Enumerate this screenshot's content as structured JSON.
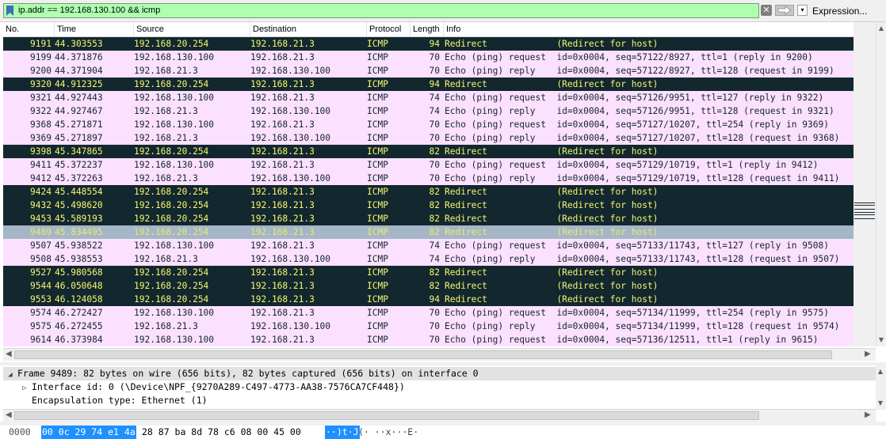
{
  "filter": {
    "text": "ip.addr == 192.168.130.100 && icmp",
    "expression_label": "Expression...",
    "clear_glyph": "✕",
    "dropdown_glyph": "▾",
    "bookmark_icon": "bookmark-icon",
    "background_color": "#afffaf"
  },
  "columns": {
    "no": "No.",
    "time": "Time",
    "source": "Source",
    "destination": "Destination",
    "protocol": "Protocol",
    "length": "Length",
    "info": "Info"
  },
  "colors": {
    "redirect_bg": "#12272e",
    "redirect_fg": "#f7f771",
    "echo_bg": "#fce0ff",
    "echo_fg": "#12272e",
    "selected_bg": "#a5b6c8"
  },
  "packets": [
    {
      "no": "9191",
      "time": "44.303553",
      "src": "192.168.20.254",
      "dst": "192.168.21.3",
      "proto": "ICMP",
      "len": "94",
      "info": "Redirect             (Redirect for host)",
      "kind": "redirect"
    },
    {
      "no": "9199",
      "time": "44.371876",
      "src": "192.168.130.100",
      "dst": "192.168.21.3",
      "proto": "ICMP",
      "len": "70",
      "info": "Echo (ping) request  id=0x0004, seq=57122/8927, ttl=1 (reply in 9200)",
      "kind": "echo"
    },
    {
      "no": "9200",
      "time": "44.371904",
      "src": "192.168.21.3",
      "dst": "192.168.130.100",
      "proto": "ICMP",
      "len": "70",
      "info": "Echo (ping) reply    id=0x0004, seq=57122/8927, ttl=128 (request in 9199)",
      "kind": "echo"
    },
    {
      "no": "9320",
      "time": "44.912325",
      "src": "192.168.20.254",
      "dst": "192.168.21.3",
      "proto": "ICMP",
      "len": "94",
      "info": "Redirect             (Redirect for host)",
      "kind": "redirect"
    },
    {
      "no": "9321",
      "time": "44.927443",
      "src": "192.168.130.100",
      "dst": "192.168.21.3",
      "proto": "ICMP",
      "len": "74",
      "info": "Echo (ping) request  id=0x0004, seq=57126/9951, ttl=127 (reply in 9322)",
      "kind": "echo"
    },
    {
      "no": "9322",
      "time": "44.927467",
      "src": "192.168.21.3",
      "dst": "192.168.130.100",
      "proto": "ICMP",
      "len": "74",
      "info": "Echo (ping) reply    id=0x0004, seq=57126/9951, ttl=128 (request in 9321)",
      "kind": "echo"
    },
    {
      "no": "9368",
      "time": "45.271871",
      "src": "192.168.130.100",
      "dst": "192.168.21.3",
      "proto": "ICMP",
      "len": "70",
      "info": "Echo (ping) request  id=0x0004, seq=57127/10207, ttl=254 (reply in 9369)",
      "kind": "echo"
    },
    {
      "no": "9369",
      "time": "45.271897",
      "src": "192.168.21.3",
      "dst": "192.168.130.100",
      "proto": "ICMP",
      "len": "70",
      "info": "Echo (ping) reply    id=0x0004, seq=57127/10207, ttl=128 (request in 9368)",
      "kind": "echo"
    },
    {
      "no": "9398",
      "time": "45.347865",
      "src": "192.168.20.254",
      "dst": "192.168.21.3",
      "proto": "ICMP",
      "len": "82",
      "info": "Redirect             (Redirect for host)",
      "kind": "redirect"
    },
    {
      "no": "9411",
      "time": "45.372237",
      "src": "192.168.130.100",
      "dst": "192.168.21.3",
      "proto": "ICMP",
      "len": "70",
      "info": "Echo (ping) request  id=0x0004, seq=57129/10719, ttl=1 (reply in 9412)",
      "kind": "echo"
    },
    {
      "no": "9412",
      "time": "45.372263",
      "src": "192.168.21.3",
      "dst": "192.168.130.100",
      "proto": "ICMP",
      "len": "70",
      "info": "Echo (ping) reply    id=0x0004, seq=57129/10719, ttl=128 (request in 9411)",
      "kind": "echo"
    },
    {
      "no": "9424",
      "time": "45.448554",
      "src": "192.168.20.254",
      "dst": "192.168.21.3",
      "proto": "ICMP",
      "len": "82",
      "info": "Redirect             (Redirect for host)",
      "kind": "redirect"
    },
    {
      "no": "9432",
      "time": "45.498620",
      "src": "192.168.20.254",
      "dst": "192.168.21.3",
      "proto": "ICMP",
      "len": "82",
      "info": "Redirect             (Redirect for host)",
      "kind": "redirect"
    },
    {
      "no": "9453",
      "time": "45.589193",
      "src": "192.168.20.254",
      "dst": "192.168.21.3",
      "proto": "ICMP",
      "len": "82",
      "info": "Redirect             (Redirect for host)",
      "kind": "redirect"
    },
    {
      "no": "9489",
      "time": "45.834495",
      "src": "192.168.20.254",
      "dst": "192.168.21.3",
      "proto": "ICMP",
      "len": "82",
      "info": "Redirect             (Redirect for host)",
      "kind": "selected"
    },
    {
      "no": "9507",
      "time": "45.938522",
      "src": "192.168.130.100",
      "dst": "192.168.21.3",
      "proto": "ICMP",
      "len": "74",
      "info": "Echo (ping) request  id=0x0004, seq=57133/11743, ttl=127 (reply in 9508)",
      "kind": "echo"
    },
    {
      "no": "9508",
      "time": "45.938553",
      "src": "192.168.21.3",
      "dst": "192.168.130.100",
      "proto": "ICMP",
      "len": "74",
      "info": "Echo (ping) reply    id=0x0004, seq=57133/11743, ttl=128 (request in 9507)",
      "kind": "echo"
    },
    {
      "no": "9527",
      "time": "45.980568",
      "src": "192.168.20.254",
      "dst": "192.168.21.3",
      "proto": "ICMP",
      "len": "82",
      "info": "Redirect             (Redirect for host)",
      "kind": "redirect"
    },
    {
      "no": "9544",
      "time": "46.050648",
      "src": "192.168.20.254",
      "dst": "192.168.21.3",
      "proto": "ICMP",
      "len": "82",
      "info": "Redirect             (Redirect for host)",
      "kind": "redirect"
    },
    {
      "no": "9553",
      "time": "46.124058",
      "src": "192.168.20.254",
      "dst": "192.168.21.3",
      "proto": "ICMP",
      "len": "94",
      "info": "Redirect             (Redirect for host)",
      "kind": "redirect"
    },
    {
      "no": "9574",
      "time": "46.272427",
      "src": "192.168.130.100",
      "dst": "192.168.21.3",
      "proto": "ICMP",
      "len": "70",
      "info": "Echo (ping) request  id=0x0004, seq=57134/11999, ttl=254 (reply in 9575)",
      "kind": "echo"
    },
    {
      "no": "9575",
      "time": "46.272455",
      "src": "192.168.21.3",
      "dst": "192.168.130.100",
      "proto": "ICMP",
      "len": "70",
      "info": "Echo (ping) reply    id=0x0004, seq=57134/11999, ttl=128 (request in 9574)",
      "kind": "echo"
    },
    {
      "no": "9614",
      "time": "46.373984",
      "src": "192.168.130.100",
      "dst": "192.168.21.3",
      "proto": "ICMP",
      "len": "70",
      "info": "Echo (ping) request  id=0x0004, seq=57136/12511, ttl=1 (reply in 9615)",
      "kind": "echo"
    }
  ],
  "details": {
    "frame": "Frame 9489: 82 bytes on wire (656 bits), 82 bytes captured (656 bits) on interface 0",
    "interface": "Interface id: 0 (\\Device\\NPF_{9270A289-C497-4773-AA38-7576CA7CF448})",
    "encapsulation": "Encapsulation type: Ethernet (1)",
    "expanded_glyph": "◢",
    "collapsed_glyph": "▷"
  },
  "bytes": {
    "offset": "0000",
    "hex_highlight": "00 0c 29 74 e1 4a",
    "hex_rest": "28 87  ba 8d 78 c6 08 00 45 00",
    "ascii_highlight": "··)t·J",
    "ascii_rest": "(· ··x···E·"
  }
}
